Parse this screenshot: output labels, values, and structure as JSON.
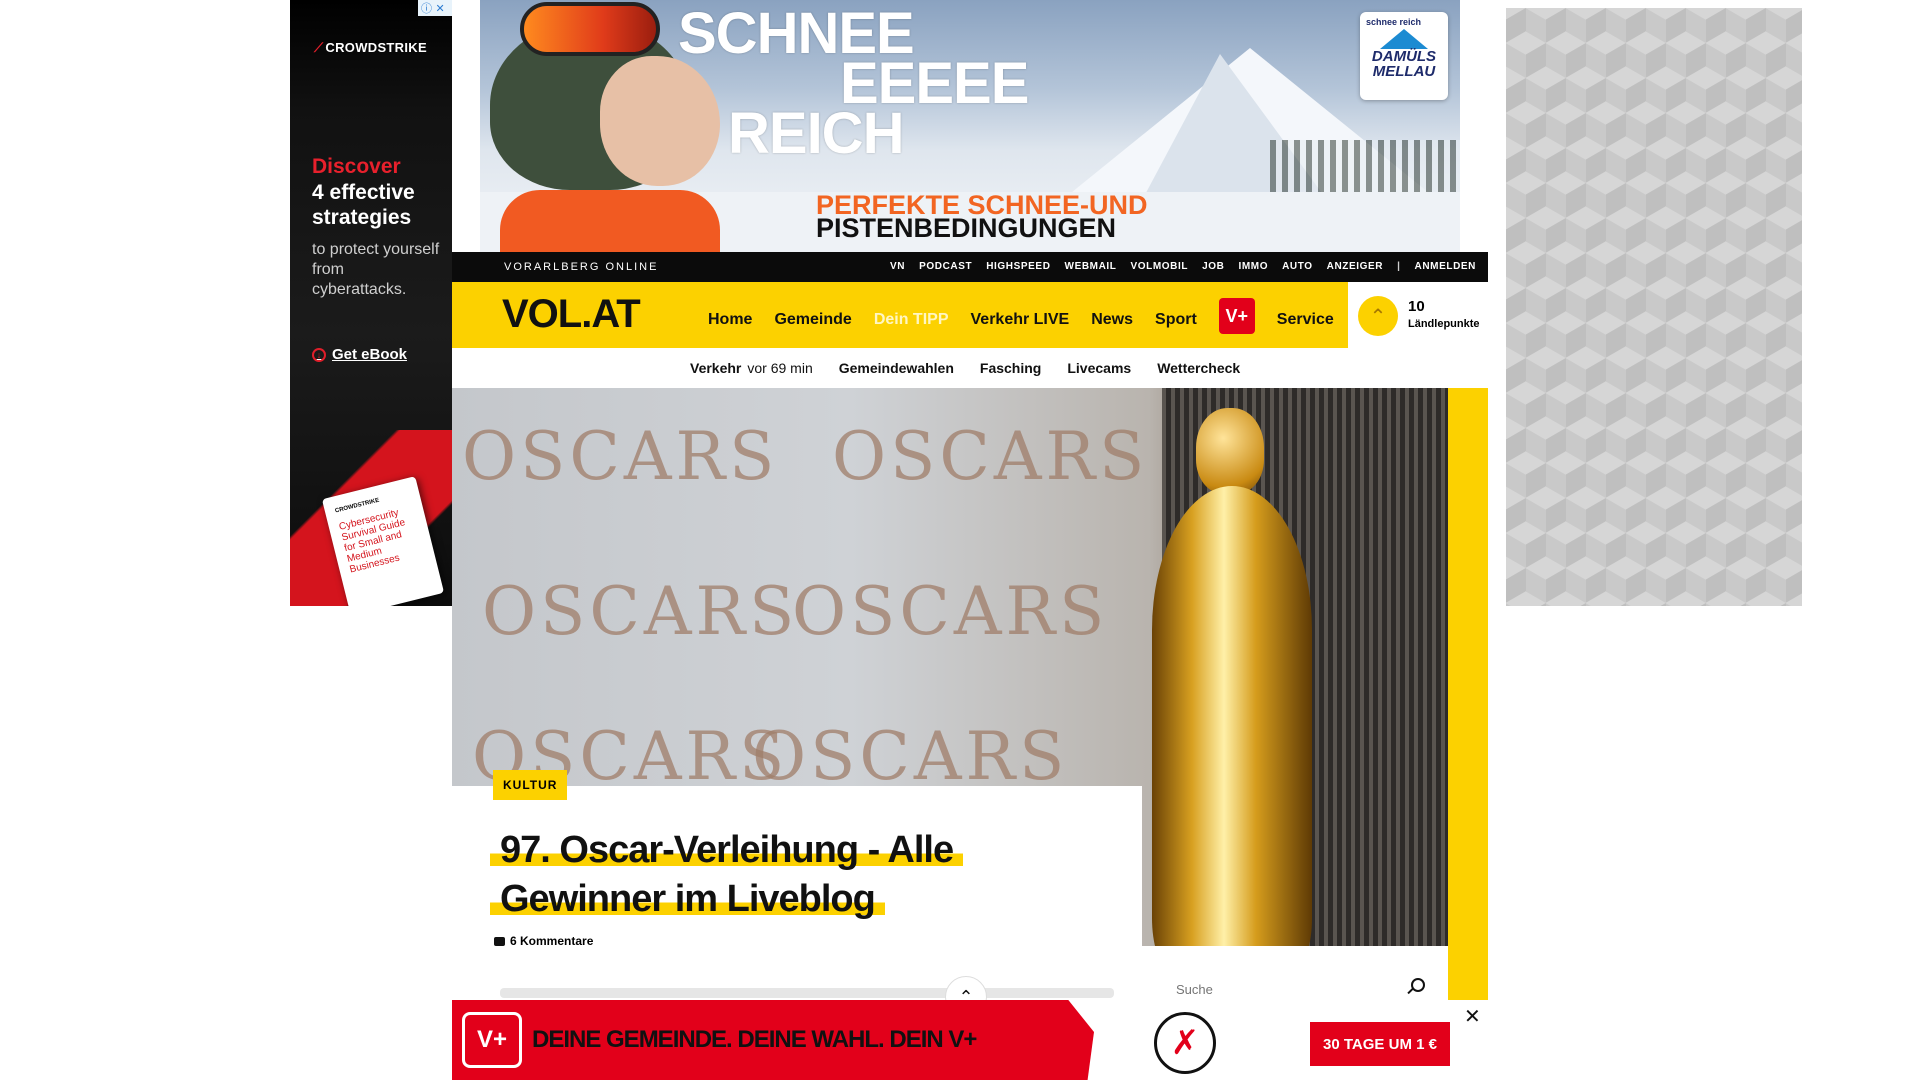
{
  "ad_left": {
    "adchoices_icons": "ⓘ ✕",
    "brand": "CROWDSTRIKE",
    "discover": "Discover",
    "strategies": "4 effective strategies",
    "protect": "to protect yourself from cyberattacks.",
    "cta": "Get eBook",
    "book_brand": "CROWDSTRIKE",
    "book_title": "Cybersecurity Survival Guide for Small and Medium Businesses"
  },
  "ad_top": {
    "line1": "SCHNEE",
    "line2": "EEEEE",
    "line3": "REICH",
    "sub1": "PERFEKTE SCHNEE-UND",
    "sub2": "PISTENBEDINGUNGEN",
    "badge_top": "schnee reich",
    "badge_name": "DAMÜLS MELLAU"
  },
  "topbar": {
    "site": "VORARLBERG ONLINE",
    "links": [
      "VN",
      "PODCAST",
      "HIGHSPEED",
      "WEBMAIL",
      "VOLMOBIL",
      "JOB",
      "IMMO",
      "AUTO",
      "ANZEIGER",
      "|",
      "ANMELDEN"
    ]
  },
  "nav": {
    "logo": "VOL.AT",
    "items": [
      "Home",
      "Gemeinde",
      "Dein TIPP",
      "Verkehr LIVE",
      "News",
      "Sport"
    ],
    "vplus": "V+",
    "service": "Service",
    "points_value": "10",
    "points_label": "Ländlepunkte"
  },
  "subnav": {
    "traffic": "Verkehr",
    "traffic_time": "vor 69 min",
    "items": [
      "Gemeindewahlen",
      "Fasching",
      "Livecams",
      "Wettercheck"
    ]
  },
  "hero": {
    "watermark": "OSCARS",
    "category": "KULTUR",
    "headline_line1": "97. Oscar-Verleihung - Alle",
    "headline_line2": "Gewinner im Liveblog",
    "comments": "6 Kommentare"
  },
  "search": {
    "placeholder": "Suche"
  },
  "sticky": {
    "logo": "V+",
    "slogan": "DEINE GEMEINDE. DEINE WAHL. DEIN V+",
    "cta": "30 TAGE UM 1 €",
    "close": "✕"
  },
  "colors": {
    "brand_yellow": "#fcd100",
    "brand_red": "#e2001a"
  }
}
